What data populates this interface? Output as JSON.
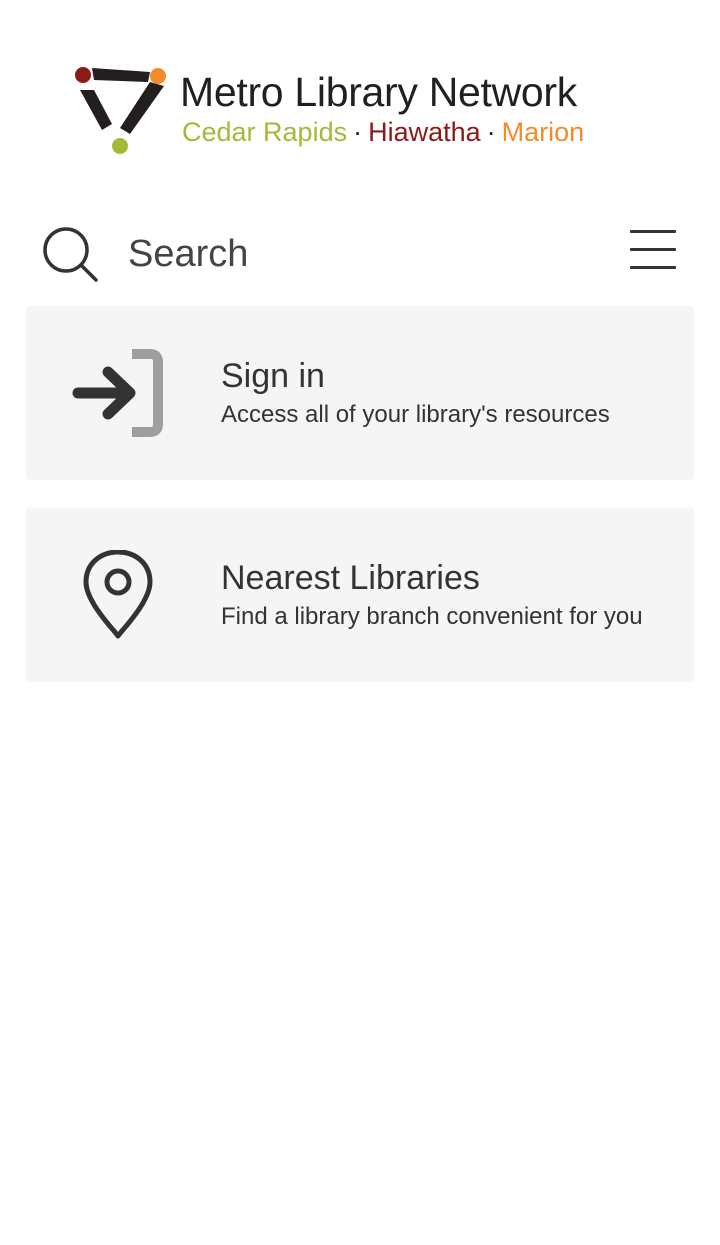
{
  "logo": {
    "title": "Metro Library Network",
    "cities": [
      {
        "name": "Cedar Rapids",
        "color": "#a6b937"
      },
      {
        "name": "Hiawatha",
        "color": "#8b1a1a"
      },
      {
        "name": "Marion",
        "color": "#f28c28"
      }
    ],
    "separator": "·"
  },
  "search": {
    "placeholder": "Search",
    "value": ""
  },
  "icons": {
    "search": "search-icon",
    "menu": "hamburger-menu-icon",
    "sign_in": "sign-in-arrow-icon",
    "location": "map-pin-icon"
  },
  "cards": [
    {
      "title": "Sign in",
      "description": "Access all of your library's resources"
    },
    {
      "title": "Nearest Libraries",
      "description": "Find a library branch convenient for you"
    }
  ],
  "colors": {
    "card_background": "#f5f5f5",
    "text": "#333333",
    "icon_gray": "#9e9e9e"
  }
}
